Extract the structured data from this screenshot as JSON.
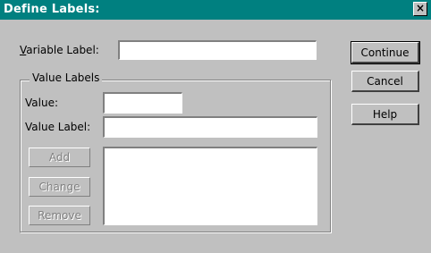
{
  "window": {
    "title": "Define Labels:",
    "close_symbol": "×"
  },
  "variable_label": {
    "label": "Variable Label:",
    "mnemonic": "V",
    "value": ""
  },
  "value_labels_group": {
    "legend": "Value Labels",
    "value": {
      "label": "Value:",
      "value": ""
    },
    "value_label": {
      "label": "Value Label:",
      "value": ""
    },
    "list_items": [],
    "buttons": {
      "add": "Add",
      "change": "Change",
      "remove": "Remove"
    }
  },
  "dialog_buttons": {
    "continue": "Continue",
    "cancel": "Cancel",
    "help": "Help"
  }
}
